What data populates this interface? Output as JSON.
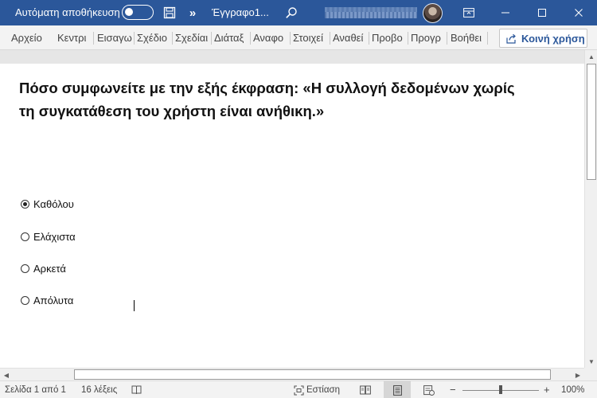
{
  "titlebar": {
    "autosave_label": "Αυτόματη αποθήκευση",
    "autosave_state": "off",
    "more_glyph": "»",
    "doc_title": "Έγγραφο1...",
    "icons": [
      "save-icon",
      "search-icon",
      "ribbon-display-icon",
      "minimize-icon",
      "maximize-icon",
      "close-icon"
    ]
  },
  "ribbon": {
    "tabs": [
      "Αρχείο",
      "Κεντρι",
      "Εισαγω",
      "Σχέδιο",
      "Σχεδίαι",
      "Διάταξ",
      "Αναφο",
      "Στοιχεί",
      "Αναθεί",
      "Προβο",
      "Προγρ",
      "Βοήθει"
    ],
    "share_label": "Κοινή χρήση"
  },
  "document": {
    "question": "Πόσο συμφωνείτε με την εξής έκφραση: «Η συλλογή δεδομένων χωρίς τη συγκατάθεση του χρήστη είναι ανήθικη.»",
    "options": [
      "Καθόλου",
      "Ελάχιστα",
      "Αρκετά",
      "Απόλυτα"
    ],
    "selected_option": "Καθόλου"
  },
  "statusbar": {
    "page": "Σελίδα 1 από 1",
    "words": "16 λέξεις",
    "focus_label": "Εστίαση",
    "zoom_out": "−",
    "zoom_in": "+",
    "zoom": "100%"
  },
  "colors": {
    "titlebar": "#2b579a",
    "accent": "#2b579a"
  }
}
